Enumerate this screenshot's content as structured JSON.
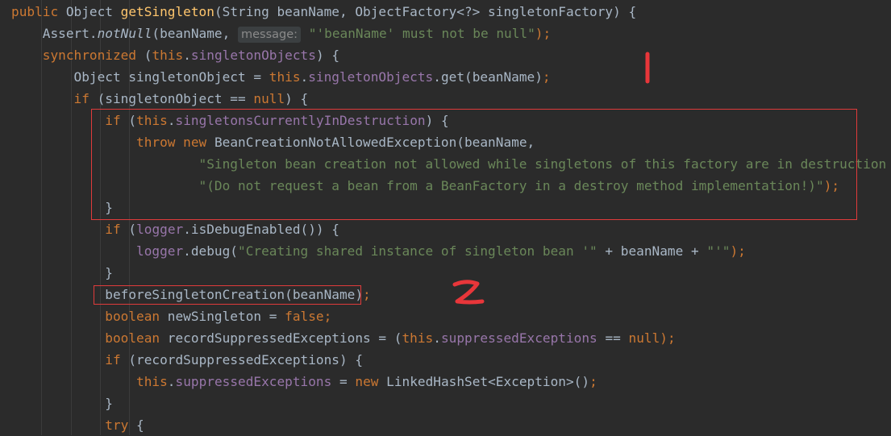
{
  "code": {
    "lines": [
      [
        {
          "t": "public ",
          "c": "kw"
        },
        {
          "t": "Object "
        },
        {
          "t": "getSingleton",
          "c": "fn"
        },
        {
          "t": "(String beanName, ObjectFactory<?> singletonFactory) {"
        }
      ],
      [
        {
          "t": "    Assert."
        },
        {
          "t": "notNull",
          "c": "it"
        },
        {
          "t": "(beanName, "
        },
        {
          "t": "message:",
          "c": "hint"
        },
        {
          "t": " "
        },
        {
          "t": "\"'beanName' must not be null\"",
          "c": "str"
        },
        {
          "t": ");",
          "c": "kw"
        }
      ],
      [
        {
          "t": "    "
        },
        {
          "t": "synchronized ",
          "c": "kw"
        },
        {
          "t": "("
        },
        {
          "t": "this",
          "c": "kw"
        },
        {
          "t": "."
        },
        {
          "t": "singletonObjects",
          "c": "fld"
        },
        {
          "t": ") {"
        }
      ],
      [
        {
          "t": "        Object singletonObject = "
        },
        {
          "t": "this",
          "c": "kw"
        },
        {
          "t": "."
        },
        {
          "t": "singletonObjects",
          "c": "fld"
        },
        {
          "t": ".get(beanName)"
        },
        {
          "t": ";",
          "c": "kw"
        }
      ],
      [
        {
          "t": "        "
        },
        {
          "t": "if ",
          "c": "kw"
        },
        {
          "t": "(singletonObject == "
        },
        {
          "t": "null",
          "c": "kw"
        },
        {
          "t": ") {"
        }
      ],
      [
        {
          "t": "            "
        },
        {
          "t": "if ",
          "c": "kw"
        },
        {
          "t": "("
        },
        {
          "t": "this",
          "c": "kw"
        },
        {
          "t": "."
        },
        {
          "t": "singletonsCurrentlyInDestruction",
          "c": "fld"
        },
        {
          "t": ") {"
        }
      ],
      [
        {
          "t": "                "
        },
        {
          "t": "throw new ",
          "c": "kw"
        },
        {
          "t": "BeanCreationNotAllowedException(beanName,"
        }
      ],
      [
        {
          "t": "                        "
        },
        {
          "t": "\"Singleton bean creation not allowed while singletons of this factory are in destruction \"",
          "c": "str"
        },
        {
          "t": " +"
        }
      ],
      [
        {
          "t": "                        "
        },
        {
          "t": "\"(Do not request a bean from a BeanFactory in a destroy method implementation!)\"",
          "c": "str"
        },
        {
          "t": ");",
          "c": "kw"
        }
      ],
      [
        {
          "t": "            }"
        }
      ],
      [
        {
          "t": "            "
        },
        {
          "t": "if ",
          "c": "kw"
        },
        {
          "t": "("
        },
        {
          "t": "logger",
          "c": "fld"
        },
        {
          "t": ".isDebugEnabled()) {"
        }
      ],
      [
        {
          "t": "                "
        },
        {
          "t": "logger",
          "c": "fld"
        },
        {
          "t": ".debug("
        },
        {
          "t": "\"Creating shared instance of singleton bean '\"",
          "c": "str"
        },
        {
          "t": " + beanName + "
        },
        {
          "t": "\"'\"",
          "c": "str"
        },
        {
          "t": ");",
          "c": "kw"
        }
      ],
      [
        {
          "t": "            }"
        }
      ],
      [
        {
          "t": "            beforeSingletonCreation(beanName)"
        },
        {
          "t": ";",
          "c": "kw"
        }
      ],
      [
        {
          "t": "            "
        },
        {
          "t": "boolean ",
          "c": "kw"
        },
        {
          "t": "newSingleton = "
        },
        {
          "t": "false;",
          "c": "kw"
        }
      ],
      [
        {
          "t": "            "
        },
        {
          "t": "boolean ",
          "c": "kw"
        },
        {
          "t": "recordSuppressedExceptions = ("
        },
        {
          "t": "this",
          "c": "kw"
        },
        {
          "t": "."
        },
        {
          "t": "suppressedExceptions",
          "c": "fld"
        },
        {
          "t": " == "
        },
        {
          "t": "null",
          "c": "kw"
        },
        {
          "t": ");",
          "c": "kw"
        }
      ],
      [
        {
          "t": "            "
        },
        {
          "t": "if ",
          "c": "kw"
        },
        {
          "t": "(recordSuppressedExceptions) {"
        }
      ],
      [
        {
          "t": "                "
        },
        {
          "t": "this",
          "c": "kw"
        },
        {
          "t": "."
        },
        {
          "t": "suppressedExceptions",
          "c": "fld"
        },
        {
          "t": " = "
        },
        {
          "t": "new ",
          "c": "kw"
        },
        {
          "t": "LinkedHashSet<Exception>()"
        },
        {
          "t": ";",
          "c": "kw"
        }
      ],
      [
        {
          "t": "            }"
        }
      ],
      [
        {
          "t": "            "
        },
        {
          "t": "try ",
          "c": "kw"
        },
        {
          "t": "{"
        }
      ]
    ]
  },
  "annotations": {
    "mark_1": {
      "label": "1",
      "color": "#e8363a"
    },
    "mark_2": {
      "label": "2",
      "color": "#e8363a"
    }
  }
}
